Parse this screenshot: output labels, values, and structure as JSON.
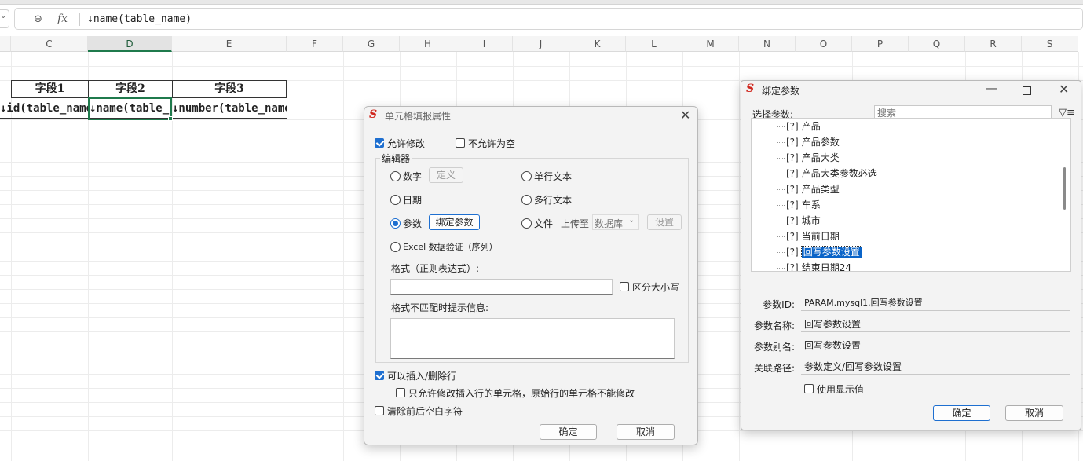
{
  "formula_bar": {
    "zoom_icon": "zoom-icon",
    "fx_label": "fx",
    "formula": "↓name(table_name)"
  },
  "sheet": {
    "columns": [
      "C",
      "D",
      "E",
      "F",
      "G",
      "H",
      "I",
      "J",
      "K",
      "L",
      "M",
      "N",
      "O",
      "P",
      "Q",
      "R",
      "S"
    ],
    "selected_column": "D",
    "header_cells": [
      "字段1",
      "字段2",
      "字段3"
    ],
    "data_cells": [
      "↓id(table_name)",
      "↓name(table_name)",
      "↓number(table_name)"
    ],
    "accent_color": "#1f7a4c"
  },
  "cell_dialog": {
    "title": "单元格填报属性",
    "allow_edit": "允许修改",
    "not_null": "不允许为空",
    "editor_group": "编辑器",
    "opt_number": "数字",
    "btn_define": "定义",
    "opt_single_text": "单行文本",
    "opt_date": "日期",
    "opt_multi_text": "多行文本",
    "opt_param": "参数",
    "btn_bind_param": "绑定参数",
    "opt_file": "文件",
    "upload_to": "上传至",
    "upload_target": "数据库",
    "btn_settings": "设置",
    "opt_excel": "Excel 数据验证（序列）",
    "format_label": "格式（正则表达式）:",
    "case_sensitive": "区分大小写",
    "mismatch_label": "格式不匹配时提示信息:",
    "allow_insert_delete": "可以插入/删除行",
    "only_insert_rows": "只允许修改插入行的单元格，原始行的单元格不能修改",
    "trim_spaces": "清除前后空白字符",
    "ok": "确定",
    "cancel": "取消"
  },
  "bind_dialog": {
    "title": "绑定参数",
    "select_label": "选择参数:",
    "search_placeholder": "搜索",
    "tree_marker": "[?]",
    "tree_items": [
      "产品",
      "产品参数",
      "产品大类",
      "产品大类参数必选",
      "产品类型",
      "车系",
      "城市",
      "当前日期",
      "回写参数设置",
      "结束日期24"
    ],
    "selected_item": "回写参数设置",
    "fields": [
      {
        "label": "参数ID:",
        "value": "PARAM.mysql1.回写参数设置"
      },
      {
        "label": "参数名称:",
        "value": "回写参数设置"
      },
      {
        "label": "参数别名:",
        "value": "回写参数设置"
      },
      {
        "label": "关联路径:",
        "value": "参数定义/回写参数设置"
      }
    ],
    "use_display_value": "使用显示值",
    "ok": "确定",
    "cancel": "取消"
  }
}
